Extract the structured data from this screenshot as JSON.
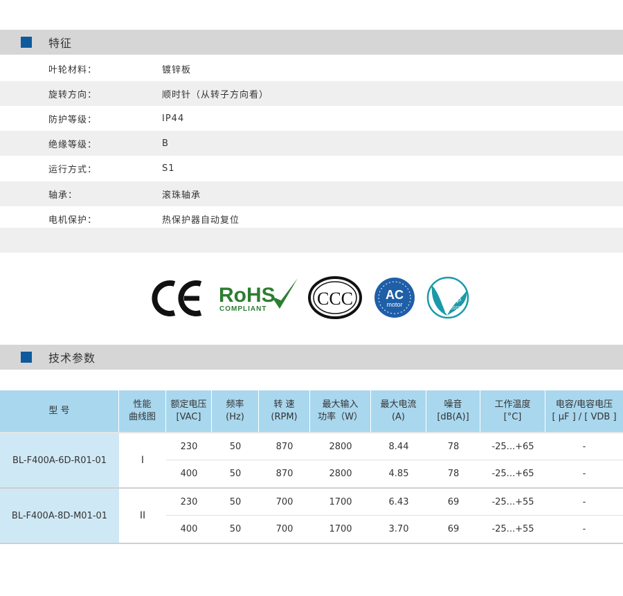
{
  "features": {
    "title": "特征",
    "rows": [
      {
        "label": "叶轮材料：",
        "value": "镀锌板"
      },
      {
        "label": "旋转方向：",
        "value": "顺时针（从转子方向看）"
      },
      {
        "label": "防护等级：",
        "value": "IP44"
      },
      {
        "label": "绝缘等级：",
        "value": "B"
      },
      {
        "label": "运行方式：",
        "value": "S1"
      },
      {
        "label": "轴承：",
        "value": "滚珠轴承"
      },
      {
        "label": "电机保护：",
        "value": "热保护器自动复位"
      }
    ]
  },
  "certifications": {
    "ce": "CE",
    "rohs": "RoHS",
    "rohs_sub": "COMPLIANT",
    "ccc": "CCC",
    "ac": "AC",
    "ac_sub": "motor",
    "erp": "ErP",
    "erp_year": "2015"
  },
  "specs": {
    "title": "技术参数",
    "headers": [
      "型 号",
      "性能\n曲线图",
      "额定电压\n[VAC]",
      "频率\n(Hz)",
      "转 速\n(RPM)",
      "最大输入\n功率（W）",
      "最大电流\n(A)",
      "噪音\n[dB(A)]",
      "工作温度\n[°C]",
      "电容/电容电压\n[ μF ] / [ VDB ]"
    ],
    "groups": [
      {
        "model": "BL-F400A-6D-R01-01",
        "curve": "I",
        "rows": [
          [
            "230",
            "50",
            "870",
            "2800",
            "8.44",
            "78",
            "-25...+65",
            "-"
          ],
          [
            "400",
            "50",
            "870",
            "2800",
            "4.85",
            "78",
            "-25...+65",
            "-"
          ]
        ]
      },
      {
        "model": "BL-F400A-8D-M01-01",
        "curve": "II",
        "rows": [
          [
            "230",
            "50",
            "700",
            "1700",
            "6.43",
            "69",
            "-25...+55",
            "-"
          ],
          [
            "400",
            "50",
            "700",
            "1700",
            "3.70",
            "69",
            "-25...+55",
            "-"
          ]
        ]
      }
    ]
  },
  "colors": {
    "accent": "#0e5a9c",
    "header_bg": "#a9d7ee",
    "model_bg": "#cfe8f5",
    "rohs_green": "#2e7d32",
    "ac_blue": "#1f5fa8",
    "erp_teal": "#1a9aa8"
  }
}
